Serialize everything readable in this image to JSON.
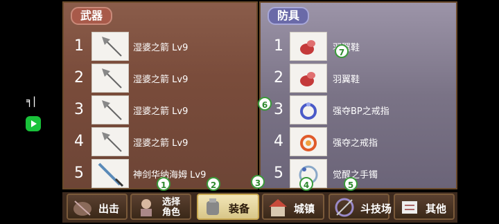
{
  "sidebar": {
    "glyph": "╕|"
  },
  "weapons": {
    "title": "武器",
    "items": [
      {
        "num": "1",
        "name": "湿婆之箭 Lv9",
        "icon": "arrow-icon"
      },
      {
        "num": "2",
        "name": "湿婆之箭 Lv9",
        "icon": "arrow-icon"
      },
      {
        "num": "3",
        "name": "湿婆之箭 Lv9",
        "icon": "arrow-icon"
      },
      {
        "num": "4",
        "name": "湿婆之箭 Lv9",
        "icon": "arrow-icon"
      },
      {
        "num": "5",
        "name": "神剑华纳海姆 Lv9",
        "icon": "sword-icon"
      }
    ]
  },
  "armor": {
    "title": "防具",
    "items": [
      {
        "num": "1",
        "name": "羽翼鞋",
        "icon": "winged-boots-icon"
      },
      {
        "num": "2",
        "name": "羽翼鞋",
        "icon": "winged-boots-icon"
      },
      {
        "num": "3",
        "name": "强夺BP之戒指",
        "icon": "ring-icon"
      },
      {
        "num": "4",
        "name": "强夺之戒指",
        "icon": "ring-icon"
      },
      {
        "num": "5",
        "name": "觉醒之手镯",
        "icon": "bracelet-icon"
      }
    ]
  },
  "nav": {
    "items": [
      {
        "label": "出击",
        "icon": "sortie-icon"
      },
      {
        "label1": "选择",
        "label2": "角色",
        "icon": "character-icon"
      },
      {
        "label": "装备",
        "icon": "armor-icon",
        "active": true
      },
      {
        "label": "城镇",
        "icon": "town-icon"
      },
      {
        "label": "斗技场",
        "icon": "arena-icon"
      },
      {
        "label": "其他",
        "icon": "other-icon"
      }
    ]
  },
  "markers": [
    "1",
    "2",
    "3",
    "4",
    "5",
    "6",
    "7"
  ],
  "colors": {
    "marker": "#3a9a3a",
    "active_tab": "#f2e6b8"
  }
}
